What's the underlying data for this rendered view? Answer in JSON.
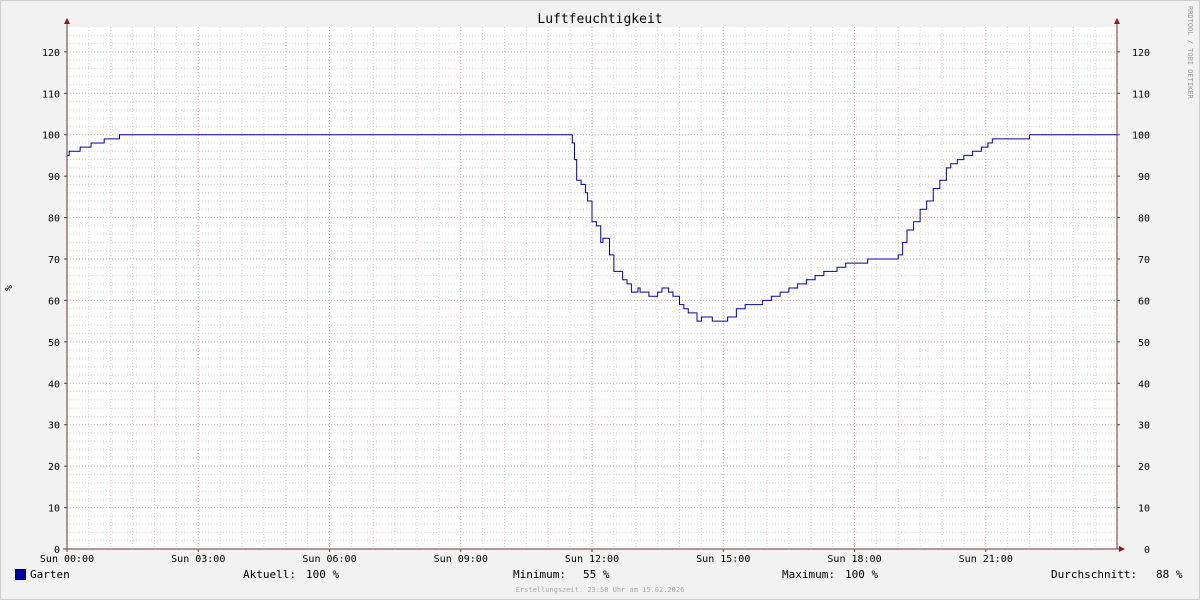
{
  "chart_data": {
    "type": "line",
    "title": "Luftfeuchtigkeit",
    "ylabel": "%",
    "ylim": [
      0,
      126
    ],
    "yticks": [
      0,
      10,
      20,
      30,
      40,
      50,
      60,
      70,
      80,
      90,
      100,
      110,
      120
    ],
    "xlim": [
      0,
      24
    ],
    "xticks": [
      {
        "x": 0,
        "label": "Sun 00:00"
      },
      {
        "x": 3,
        "label": "Sun 03:00"
      },
      {
        "x": 6,
        "label": "Sun 06:00"
      },
      {
        "x": 9,
        "label": "Sun 09:00"
      },
      {
        "x": 12,
        "label": "Sun 12:00"
      },
      {
        "x": 15,
        "label": "Sun 15:00"
      },
      {
        "x": 18,
        "label": "Sun 18:00"
      },
      {
        "x": 21,
        "label": "Sun 21:00"
      }
    ],
    "grid": true,
    "series": [
      {
        "name": "Garten",
        "color": "#0000a0",
        "x": [
          0,
          0.05,
          0.3,
          0.55,
          0.85,
          1.15,
          1.2,
          11.4,
          11.55,
          11.6,
          11.65,
          11.75,
          11.85,
          11.9,
          12.0,
          12.1,
          12.2,
          12.25,
          12.4,
          12.5,
          12.6,
          12.7,
          12.8,
          12.9,
          13.05,
          13.1,
          13.3,
          13.5,
          13.6,
          13.75,
          13.85,
          14.0,
          14.1,
          14.2,
          14.3,
          14.4,
          14.5,
          14.6,
          14.75,
          14.9,
          15.1,
          15.3,
          15.5,
          15.7,
          15.9,
          16.1,
          16.3,
          16.5,
          16.7,
          16.9,
          17.1,
          17.3,
          17.6,
          17.8,
          18.1,
          18.3,
          18.6,
          18.95,
          19.0,
          19.1,
          19.2,
          19.35,
          19.5,
          19.65,
          19.8,
          19.95,
          20.1,
          20.2,
          20.35,
          20.5,
          20.7,
          20.9,
          21.05,
          21.15,
          22.0,
          23.0,
          24.0
        ],
        "y": [
          95,
          96,
          97,
          98,
          99,
          99,
          100,
          100,
          98,
          94,
          89,
          88,
          86,
          84,
          79,
          78,
          74,
          75,
          71,
          67,
          67,
          65,
          64,
          62,
          63,
          62,
          61,
          62,
          63,
          62,
          61,
          59,
          58,
          57,
          57,
          55,
          56,
          56,
          55,
          55,
          56,
          58,
          59,
          59,
          60,
          61,
          62,
          63,
          64,
          65,
          66,
          67,
          68,
          69,
          69,
          70,
          70,
          70,
          71,
          74,
          77,
          79,
          82,
          84,
          87,
          89,
          92,
          93,
          94,
          95,
          96,
          97,
          98,
          99,
          100,
          100,
          100
        ]
      }
    ],
    "watermark": "RRDTOOL / TOBI OETIKER",
    "footer": "Erstellungszeit: 23:58 Uhr am 15.02.2026"
  },
  "legend": {
    "series_name": "Garten",
    "aktuell_label": "Aktuell:",
    "aktuell_value": "100 %",
    "minimum_label": "Minimum:",
    "minimum_value": "55 %",
    "maximum_label": "Maximum:",
    "maximum_value": "100 %",
    "avg_label": "Durchschnitt:",
    "avg_value": "88 %"
  }
}
